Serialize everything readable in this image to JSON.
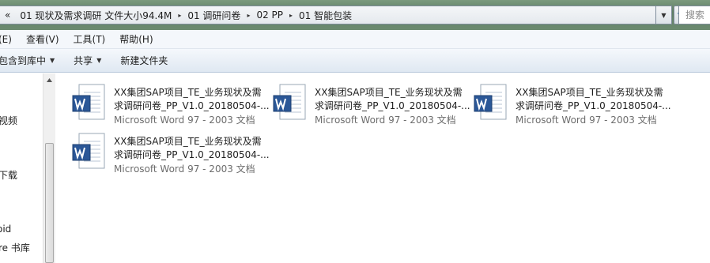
{
  "address_bar": {
    "overflow_chevron": "«",
    "crumbs": [
      "01 现状及需求调研 文件大小94.4M",
      "01 调研问卷",
      "02 PP",
      "01 智能包装"
    ],
    "separator": "▸"
  },
  "search": {
    "placeholder": "搜索"
  },
  "menu": {
    "items": [
      "(E)",
      "查看(V)",
      "工具(T)",
      "帮助(H)"
    ]
  },
  "toolbar": {
    "include_library_label": "包含到库中",
    "share_label": "共享",
    "new_folder_label": "新建文件夹",
    "dropdown_glyph": "▼"
  },
  "nav_pane": {
    "items": [
      "视频",
      "下载",
      "oid",
      "re 书库"
    ]
  },
  "files": [
    {
      "name_line1": "XX集团SAP项目_TE_业务现状及需",
      "name_line2": "求调研问卷_PP_V1.0_20180504-...",
      "type": "Microsoft Word 97 - 2003 文档"
    },
    {
      "name_line1": "XX集团SAP项目_TE_业务现状及需",
      "name_line2": "求调研问卷_PP_V1.0_20180504-...",
      "type": "Microsoft Word 97 - 2003 文档"
    },
    {
      "name_line1": "XX集团SAP项目_TE_业务现状及需",
      "name_line2": "求调研问卷_PP_V1.0_20180504-...",
      "type": "Microsoft Word 97 - 2003 文档"
    },
    {
      "name_line1": "XX集团SAP项目_TE_业务现状及需",
      "name_line2": "求调研问卷_PP_V1.0_20180504-...",
      "type": "Microsoft Word 97 - 2003 文档"
    }
  ],
  "icons": {
    "word_doc": "word-document-icon",
    "refresh": "refresh-icon",
    "nav_scroll_up": "scroll-up-arrow-icon"
  },
  "colors": {
    "word_blue": "#2b5797",
    "toolbar_bg": "#e6eef7",
    "type_gray": "#6d6d6d"
  }
}
